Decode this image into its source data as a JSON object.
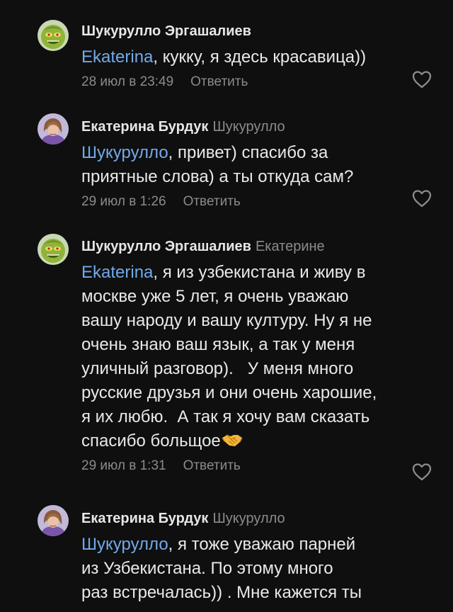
{
  "comments": [
    {
      "author": "Шукурулло Эргашалиев",
      "reply_to": "",
      "mention": "Ekaterina",
      "text": ", кукку, я здесь красавица))",
      "date": "28 июл в 23:49",
      "reply_label": "Ответить",
      "avatar_icon": "grinch-avatar",
      "like_icon": "heart-outline-icon"
    },
    {
      "author": "Екатерина Бурдук",
      "reply_to": "Шукурулло",
      "mention": "Шукурулло",
      "text": ", привет) спасибо за\nприятные слова) а ты откуда сам?",
      "date": "29 июл в 1:26",
      "reply_label": "Ответить",
      "avatar_icon": "woman-photo-avatar",
      "like_icon": "heart-outline-icon"
    },
    {
      "author": "Шукурулло Эргашалиев",
      "reply_to": "Екатерине",
      "mention": "Ekaterina",
      "text": ", я из узбекистана и живу в\nмоскве уже 5 лет, я очень уважаю\nвашу народу и вашу културу. Ну я не\nочень знаю ваш язык, а так у меня\nуличный разговор).   У меня много\nрусские друзья и они очень харошие,\nя их любю.  А так я хочу вам сказать\nспасибо больщое",
      "emoji": "handshake-emoji",
      "date": "29 июл в 1:31",
      "reply_label": "Ответить",
      "avatar_icon": "grinch-avatar",
      "like_icon": "heart-outline-icon"
    },
    {
      "author": "Екатерина Бурдук",
      "reply_to": "Шукурулло",
      "mention": "Шукурулло",
      "text": ", я тоже уважаю парней\nиз Узбекистана. По этому много\nраз встречалась)) . Мне кажется ты",
      "avatar_icon": "woman-photo-avatar"
    }
  ],
  "colors": {
    "background": "#0f0f0f",
    "text": "#e9e9e9",
    "mention": "#71aaeb",
    "secondary": "#8b8b8b"
  }
}
